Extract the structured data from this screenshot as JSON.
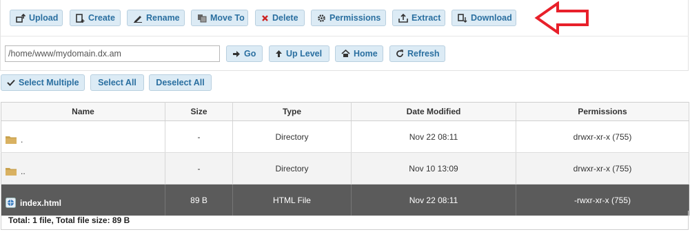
{
  "toolbar": {
    "upload": "Upload",
    "create": "Create",
    "rename": "Rename",
    "move_to": "Move To",
    "delete": "Delete",
    "permissions": "Permissions",
    "extract": "Extract",
    "download": "Download"
  },
  "navigation": {
    "path_value": "/home/www/mydomain.dx.am",
    "go": "Go",
    "up_level": "Up Level",
    "home": "Home",
    "refresh": "Refresh"
  },
  "selection": {
    "select_multiple": "Select Multiple",
    "select_all": "Select All",
    "deselect_all": "Deselect All"
  },
  "table": {
    "headers": {
      "name": "Name",
      "size": "Size",
      "type": "Type",
      "date": "Date Modified",
      "perms": "Permissions"
    },
    "rows": [
      {
        "name": ".",
        "size": "-",
        "type": "Directory",
        "date": "Nov 22 08:11",
        "perms": "drwxr-xr-x (755)",
        "icon": "folder-icon"
      },
      {
        "name": "..",
        "size": "-",
        "type": "Directory",
        "date": "Nov 10 13:09",
        "perms": "drwxr-xr-x (755)",
        "icon": "folder-icon"
      },
      {
        "name": "index.html",
        "size": "89 B",
        "type": "HTML File",
        "date": "Nov 22 08:11",
        "perms": "-rwxr-xr-x (755)",
        "icon": "web-file-icon"
      }
    ]
  },
  "summary": "Total: 1 file, Total file size: 89 B",
  "colors": {
    "button_bg": "#dcebf5",
    "button_text": "#2a6fa0",
    "selected_row": "#5b5b5b",
    "arrow": "#e8202a",
    "delete_icon": "#cc2222"
  }
}
